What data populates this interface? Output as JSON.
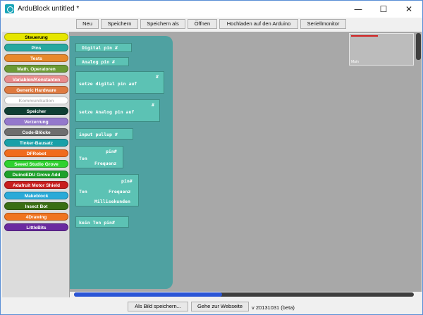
{
  "window": {
    "title": "ArduBlock untitled *"
  },
  "window_controls": {
    "minimize": "—",
    "maximize": "☐",
    "close": "✕"
  },
  "toolbar": {
    "new": "Neu",
    "save": "Speichern",
    "save_as": "Speichern als",
    "open": "Öffnen",
    "upload": "Hochladen auf den Arduino",
    "serial_monitor": "Seriellmonitor"
  },
  "categories": [
    {
      "label": "Steuerung",
      "color": "#e6e600"
    },
    {
      "label": "Pins",
      "color": "#28a8a0"
    },
    {
      "label": "Tests",
      "color": "#e8892c"
    },
    {
      "label": "Math. Operatoren",
      "color": "#6b9a34"
    },
    {
      "label": "Variablen/Konstanten",
      "color": "#e88c8c"
    },
    {
      "label": "Generic Hardware",
      "color": "#df7a40"
    },
    {
      "label": "Kommunikation",
      "color": "#ffffff"
    },
    {
      "label": "Speicher",
      "color": "#0f3e33"
    },
    {
      "label": "Verzerrung",
      "color": "#9478cc"
    },
    {
      "label": "Code-Blöcke",
      "color": "#6e6e6e"
    },
    {
      "label": "Tinker-Bausatz",
      "color": "#18a0a8"
    },
    {
      "label": "DFRobot",
      "color": "#f06c1e"
    },
    {
      "label": "Seeed Studio Grove",
      "color": "#2fd12f"
    },
    {
      "label": "DuinoEDU Grove Add",
      "color": "#1ea02a"
    },
    {
      "label": "Adafruit Motor Shield",
      "color": "#c81e1e"
    },
    {
      "label": "Makeblock",
      "color": "#2aaad8"
    },
    {
      "label": "Insect Bot",
      "color": "#3a6e14"
    },
    {
      "label": "4Drawing",
      "color": "#f07420"
    },
    {
      "label": "LittleBits",
      "color": "#6a2aa0"
    }
  ],
  "blocks": [
    {
      "label": "Digital pin #"
    },
    {
      "label": "Analog pin #"
    },
    {
      "label": "setze digital pin auf",
      "socket": "#"
    },
    {
      "label": "setze Analog pin auf",
      "socket": "#"
    },
    {
      "label": "input pullup #"
    },
    {
      "label": "Ton",
      "sockets": [
        "pin#",
        "Frequenz"
      ]
    },
    {
      "label": "Ton",
      "sockets": [
        "pin#",
        "Frequenz",
        "Millisekunden"
      ]
    },
    {
      "label": "kein Ton pin#"
    }
  ],
  "minimap": {
    "label": "Main"
  },
  "status": {
    "save_image": "Als Bild speichern...",
    "website": "Gehe zur Webseite",
    "version": "v 20131031 (beta)"
  }
}
